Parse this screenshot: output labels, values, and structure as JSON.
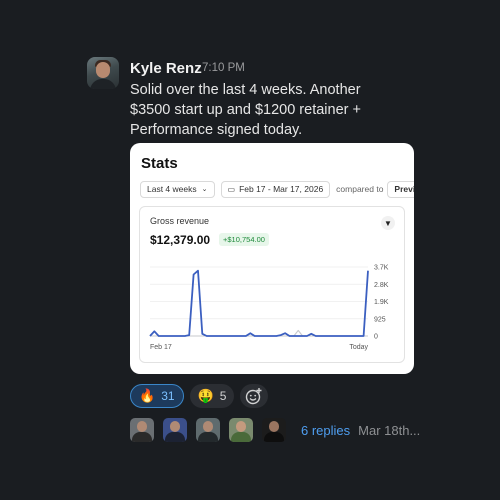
{
  "message": {
    "author": "Kyle Renz",
    "time": "7:10 PM",
    "lines": [
      "Solid over the last 4 weeks. Another",
      "$3500 start up and $1200 retainer +",
      "Performance signed today."
    ]
  },
  "stats": {
    "title": "Stats",
    "period": "Last 4 weeks",
    "date_range": "Feb 17 - Mar 17, 2026",
    "compared_to": "compared to",
    "compare_value": "Previous",
    "metric": "Gross revenue",
    "value": "$12,379.00",
    "delta": "+$10,754.00"
  },
  "chart_data": {
    "type": "line",
    "title": "Gross revenue",
    "x_start_label": "Feb 17",
    "x_end_label": "Today",
    "y_ticks": [
      "3.7K",
      "2.8K",
      "1.9K",
      "925",
      "0"
    ],
    "ylim": [
      0,
      3700
    ],
    "series": [
      {
        "values": [
          0,
          250,
          0,
          0,
          0,
          0,
          0,
          0,
          0,
          50,
          3300,
          3500,
          120,
          0,
          0,
          0,
          0,
          0,
          0,
          0,
          0,
          0,
          0,
          150,
          0,
          0,
          0,
          0,
          0,
          0,
          50,
          150,
          0,
          0,
          0,
          0,
          0,
          120,
          0,
          0,
          0,
          0,
          0,
          0,
          0,
          0,
          0,
          0,
          0,
          0,
          3500
        ],
        "color": "#3b5fc0"
      },
      {
        "values": [
          0,
          0,
          0,
          0,
          0,
          0,
          0,
          0,
          0,
          0,
          0,
          0,
          0,
          0,
          0,
          0,
          0,
          0,
          0,
          0,
          0,
          0,
          0,
          0,
          0,
          0,
          0,
          0,
          0,
          0,
          0,
          0,
          0,
          0,
          300,
          0,
          0,
          0,
          0,
          0,
          0,
          0,
          0,
          0,
          0,
          0,
          0,
          0,
          0,
          0,
          0
        ],
        "color": "#c7c9cc"
      }
    ]
  },
  "reactions": [
    {
      "emoji": "🔥",
      "count": "31",
      "active": true
    },
    {
      "emoji": "🤑",
      "count": "5",
      "active": false
    }
  ],
  "add_reaction_icon": "add-reaction-icon",
  "thread": {
    "replies": "6 replies",
    "date": "Mar 18th..."
  }
}
